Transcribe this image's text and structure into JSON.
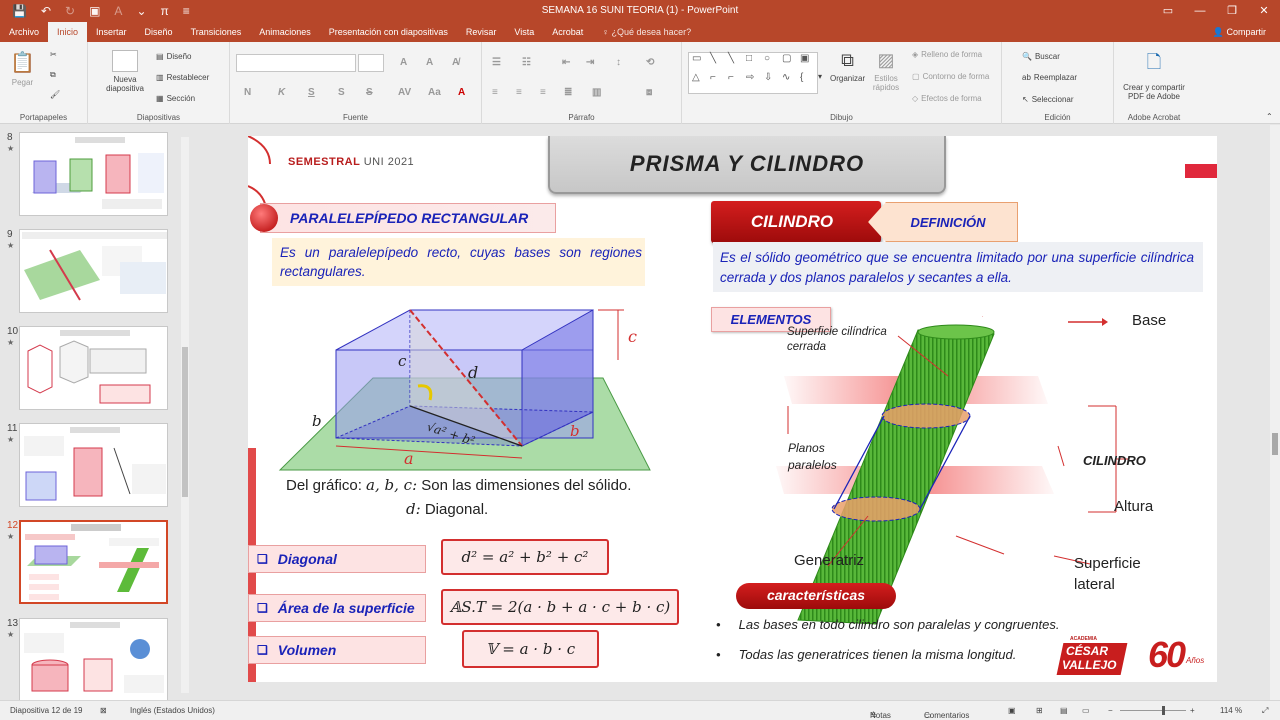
{
  "window": {
    "title": "SEMANA 16 SUNI TEORIA (1) - PowerPoint",
    "controls": [
      "▭",
      "—",
      "❐",
      "✕"
    ]
  },
  "tabs": [
    "Archivo",
    "Inicio",
    "Insertar",
    "Diseño",
    "Transiciones",
    "Animaciones",
    "Presentación con diapositivas",
    "Revisar",
    "Vista",
    "Acrobat"
  ],
  "tellme": "¿Qué desea hacer?",
  "share": "Compartir",
  "ribbon": {
    "portapapeles": {
      "paste": "Pegar",
      "label": "Portapapeles"
    },
    "diapositivas": {
      "new": "Nueva diapositiva",
      "layout": "Diseño",
      "reset": "Restablecer",
      "section": "Sección",
      "label": "Diapositivas"
    },
    "fuente": {
      "label": "Fuente",
      "bold": "N",
      "italic": "K",
      "underline": "S",
      "strike": "S"
    },
    "parrafo": {
      "label": "Párrafo"
    },
    "dibujo": {
      "arrange": "Organizar",
      "styles": "Estilos rápidos",
      "fill": "Relleno de forma",
      "outline": "Contorno de forma",
      "effects": "Efectos de forma",
      "label": "Dibujo"
    },
    "edicion": {
      "find": "Buscar",
      "replace": "Reemplazar",
      "select": "Seleccionar",
      "label": "Edición"
    },
    "acrobat": {
      "create": "Crear y compartir PDF de Adobe",
      "label": "Adobe Acrobat"
    }
  },
  "thumbnails": [
    {
      "num": "8",
      "star": "★"
    },
    {
      "num": "9",
      "star": "★"
    },
    {
      "num": "10",
      "star": "★"
    },
    {
      "num": "11",
      "star": "★"
    },
    {
      "num": "12",
      "star": "★"
    },
    {
      "num": "13",
      "star": "★"
    }
  ],
  "slide": {
    "header": "SEMESTRAL",
    "header2": "UNI 2021",
    "title": "PRISMA Y CILINDRO",
    "left_heading": "PARALELEPÍPEDO RECTANGULAR",
    "left_def": "Es un paralelepípedo recto, cuyas bases son regiones rectangulares.",
    "labels": {
      "c": "c",
      "d": "d",
      "a": "a",
      "b": "b",
      "b2": "b",
      "c2": "c",
      "diag": "√a² + b²"
    },
    "graph_line1": "Del gráfico:",
    "graph_vars": "a, b, c:",
    "graph_line1b": "Son las dimensiones del sólido.",
    "graph_var2": "d:",
    "graph_line2": "Diagonal.",
    "items": [
      {
        "label": "Diagonal",
        "formula": "d² =  a² + b² + c²"
      },
      {
        "label": "Área de la superficie",
        "formula": "𝔸S.T = 2(a · b + a · c + b · c)"
      },
      {
        "label": "Volumen",
        "formula": "𝕍 = a · b · c"
      }
    ],
    "checkbox": "❑",
    "right_heading": "CILINDRO",
    "right_tab": "DEFINICIÓN",
    "right_def": "Es el sólido geométrico que se encuentra limitado por una superficie cilíndrica cerrada y dos planos paralelos y secantes a ella.",
    "elements_label": "ELEMENTOS",
    "cyl": {
      "surface_closed": "Superficie cilíndrica cerrada",
      "base": "Base",
      "planes": "Planos paralelos",
      "cylinder": "CILINDRO",
      "height": "Altura",
      "generatrix": "Generatriz",
      "lateral": "Superficie lateral"
    },
    "features_label": "características",
    "bullets": [
      "Las bases en todo cilindro son paralelas y congruentes.",
      "Todas las generatrices tienen la misma longitud."
    ],
    "logo_small": "ACADEMIA",
    "logo_line1": "CÉSAR",
    "logo_line2": "VALLEJO",
    "logo_years": "60",
    "logo_anos": "Años"
  },
  "status": {
    "slide_of": "Diapositiva 12 de 19",
    "language": "Inglés (Estados Unidos)",
    "notes": "Notas",
    "comments": "Comentarios",
    "zoom": "114 %"
  },
  "colors": {
    "accent": "#b7472a",
    "slide_red": "#d32f2f",
    "slide_blue": "#1a23b8"
  }
}
